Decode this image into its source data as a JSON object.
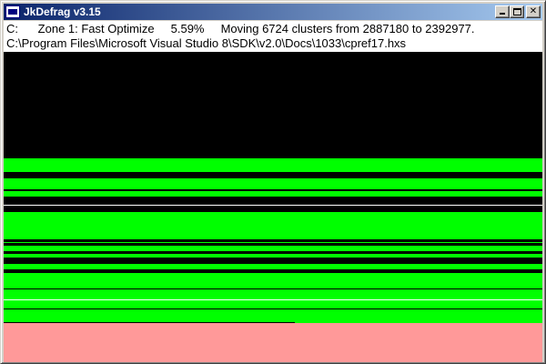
{
  "window": {
    "title": "JkDefrag v3.15",
    "minimize_glyph": "minimize-glyph",
    "maximize_glyph": "maximize-glyph",
    "close_label": "✕"
  },
  "status": {
    "drive": "C:",
    "zone": "Zone 1: Fast Optimize",
    "percent": "5.59%",
    "message": "Moving 6724 clusters from 2887180 to 2392977.",
    "current_file": "C:\\Program Files\\Microsoft Visual Studio 8\\SDK\\v2.0\\Docs\\1033\\cpref17.hxs"
  },
  "diskmap": {
    "colors": {
      "empty": "#000000",
      "fragmented": "#00ff00",
      "unmovable": "#ff9999",
      "white_line": "#ffffff"
    }
  }
}
